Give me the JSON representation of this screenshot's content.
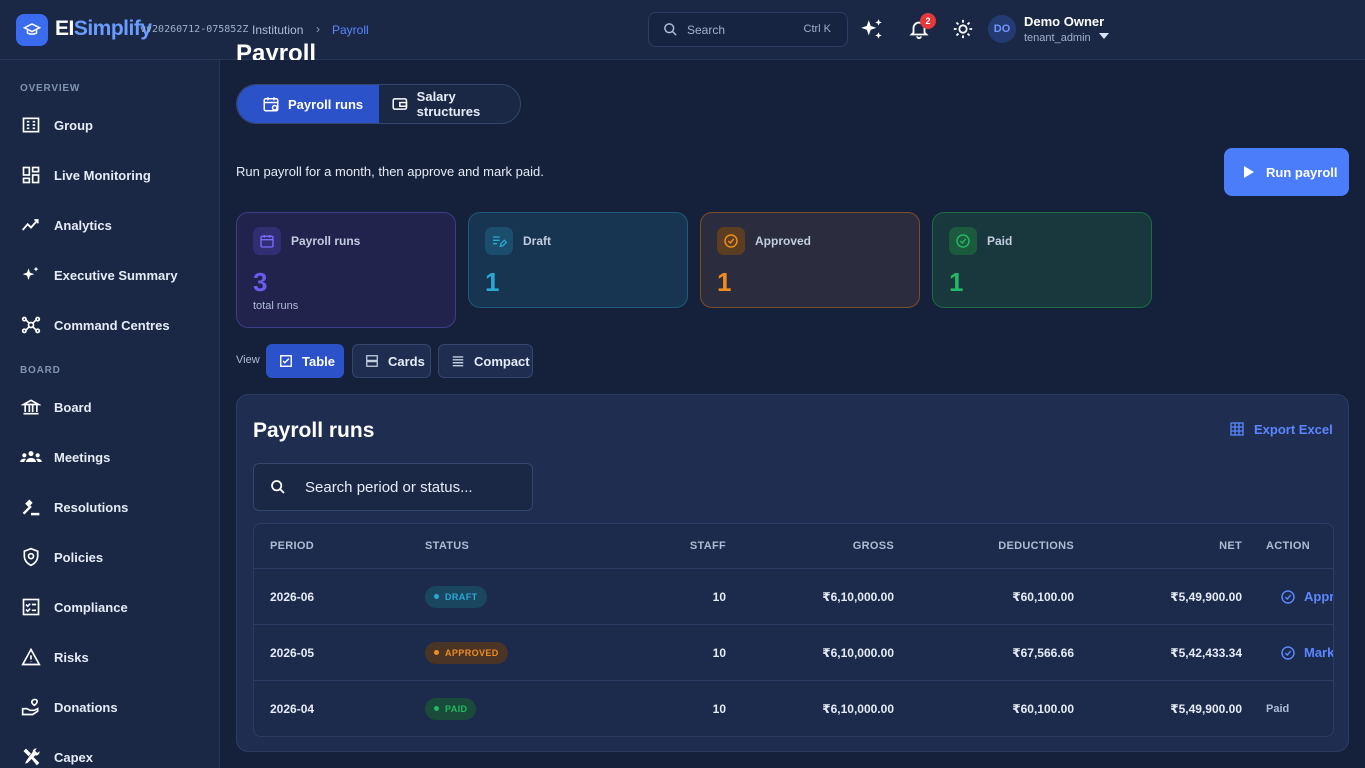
{
  "app": {
    "brand_main": "EI",
    "brand_sub": "Simplify",
    "version": "vv20260712-075852Z",
    "breadcrumb": [
      "Institution",
      "Payroll"
    ]
  },
  "topbar": {
    "search_placeholder": "Search",
    "search_shortcut": "Ctrl K",
    "notification_count": "2",
    "user_initials": "DO",
    "user_name": "Demo Owner",
    "user_role": "tenant_admin"
  },
  "sidebar": {
    "sections": [
      {
        "title": "OVERVIEW",
        "items": [
          {
            "label": "Group",
            "icon": "building-icon"
          },
          {
            "label": "Live Monitoring",
            "icon": "dashboard-icon"
          },
          {
            "label": "Analytics",
            "icon": "trend-icon"
          },
          {
            "label": "Executive Summary",
            "icon": "sparkle-icon"
          },
          {
            "label": "Command Centres",
            "icon": "hub-icon"
          }
        ]
      },
      {
        "title": "BOARD",
        "items": [
          {
            "label": "Board",
            "icon": "bank-icon"
          },
          {
            "label": "Meetings",
            "icon": "people-icon"
          },
          {
            "label": "Resolutions",
            "icon": "gavel-icon"
          },
          {
            "label": "Policies",
            "icon": "shield-icon"
          },
          {
            "label": "Compliance",
            "icon": "checklist-icon"
          },
          {
            "label": "Risks",
            "icon": "warning-icon"
          },
          {
            "label": "Donations",
            "icon": "heart-hand-icon"
          },
          {
            "label": "Capex",
            "icon": "tools-icon"
          }
        ]
      }
    ]
  },
  "page": {
    "title": "Payroll",
    "tabs": [
      "Payroll runs",
      "Salary structures"
    ],
    "description": "Run payroll for a month, then approve and mark paid.",
    "run_button": "Run payroll"
  },
  "stats": [
    {
      "label": "Payroll runs",
      "value": "3",
      "sub": "total runs",
      "color": "#6a5cf0"
    },
    {
      "label": "Draft",
      "value": "1",
      "sub": "",
      "color": "#2aa8d4"
    },
    {
      "label": "Approved",
      "value": "1",
      "sub": "",
      "color": "#f08c1e"
    },
    {
      "label": "Paid",
      "value": "1",
      "sub": "",
      "color": "#22b865"
    }
  ],
  "view": {
    "label": "View",
    "options": [
      "Table",
      "Cards",
      "Compact"
    ],
    "selected": "Table"
  },
  "table_panel": {
    "title": "Payroll runs",
    "export_label": "Export Excel",
    "search_placeholder": "Search period or status...",
    "columns": [
      "PERIOD",
      "STATUS",
      "STAFF",
      "GROSS",
      "DEDUCTIONS",
      "NET",
      "ACTION"
    ],
    "rows": [
      {
        "period": "2026-06",
        "status": "DRAFT",
        "staff": "10",
        "gross": "₹6,10,000.00",
        "deductions": "₹60,100.00",
        "net": "₹5,49,900.00",
        "action": "Approve",
        "action_type": "button"
      },
      {
        "period": "2026-05",
        "status": "APPROVED",
        "staff": "10",
        "gross": "₹6,10,000.00",
        "deductions": "₹67,566.66",
        "net": "₹5,42,433.34",
        "action": "Mark paid",
        "action_type": "button"
      },
      {
        "period": "2026-04",
        "status": "PAID",
        "staff": "10",
        "gross": "₹6,10,000.00",
        "deductions": "₹60,100.00",
        "net": "₹5,49,900.00",
        "action": "Paid",
        "action_type": "text"
      }
    ]
  },
  "colors": {
    "accent": "#4b7dfa",
    "draft": "#2aa8d4",
    "approved": "#f08c1e",
    "paid": "#22b865"
  }
}
